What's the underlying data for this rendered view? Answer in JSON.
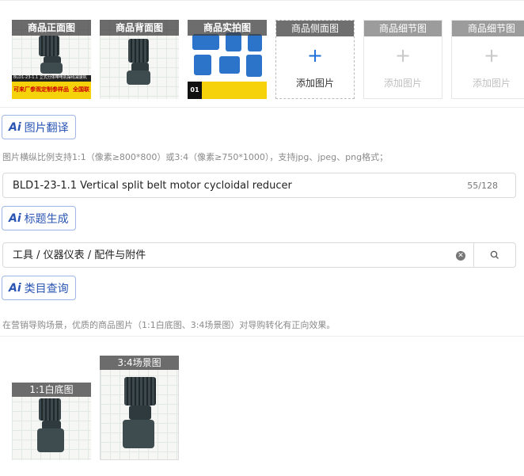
{
  "images": {
    "slots": [
      {
        "caption": "商品正面图",
        "state": "filled",
        "banner_text": "BLD1-23-1.1 立式分体带电机摆线减速机",
        "banner_left": "可来厂参观定制参样品",
        "banner_right": "全国联"
      },
      {
        "caption": "商品背面图",
        "state": "filled"
      },
      {
        "caption": "商品实拍图",
        "state": "filled",
        "banner_left": "01"
      },
      {
        "caption": "商品侧面图",
        "state": "empty",
        "add_label": "添加图片"
      },
      {
        "caption": "商品细节图",
        "state": "disabled",
        "add_label": "添加图片"
      },
      {
        "caption": "商品细节图",
        "state": "disabled",
        "add_label": "添加图片"
      }
    ],
    "translate_button": "图片翻译",
    "hint": "图片横纵比例支持1:1（像素≥800*800）或3:4（像素≥750*1000），支持jpg、jpeg、png格式；"
  },
  "title": {
    "value": "BLD1-23-1.1 Vertical split belt motor cycloidal reducer",
    "count": "55/128",
    "generate_button": "标题生成"
  },
  "category": {
    "value": "工具 / 仪器仪表 / 配件与附件",
    "query_button": "类目查询"
  },
  "marketing": {
    "hint": "在营销导购场景，优质的商品图片（1:1白底图、3:4场景图）对导购转化有正向效果。",
    "white_bg_caption": "1:1白底图",
    "scene_caption": "3:4场景图"
  },
  "icons": {
    "ai": "ai-icon",
    "plus": "plus-icon",
    "search": "search-icon",
    "clear": "clear-icon"
  },
  "colors": {
    "accent": "#2a55b3",
    "plus_blue": "#1e6fd9",
    "banner_yellow": "#f5d20a"
  }
}
